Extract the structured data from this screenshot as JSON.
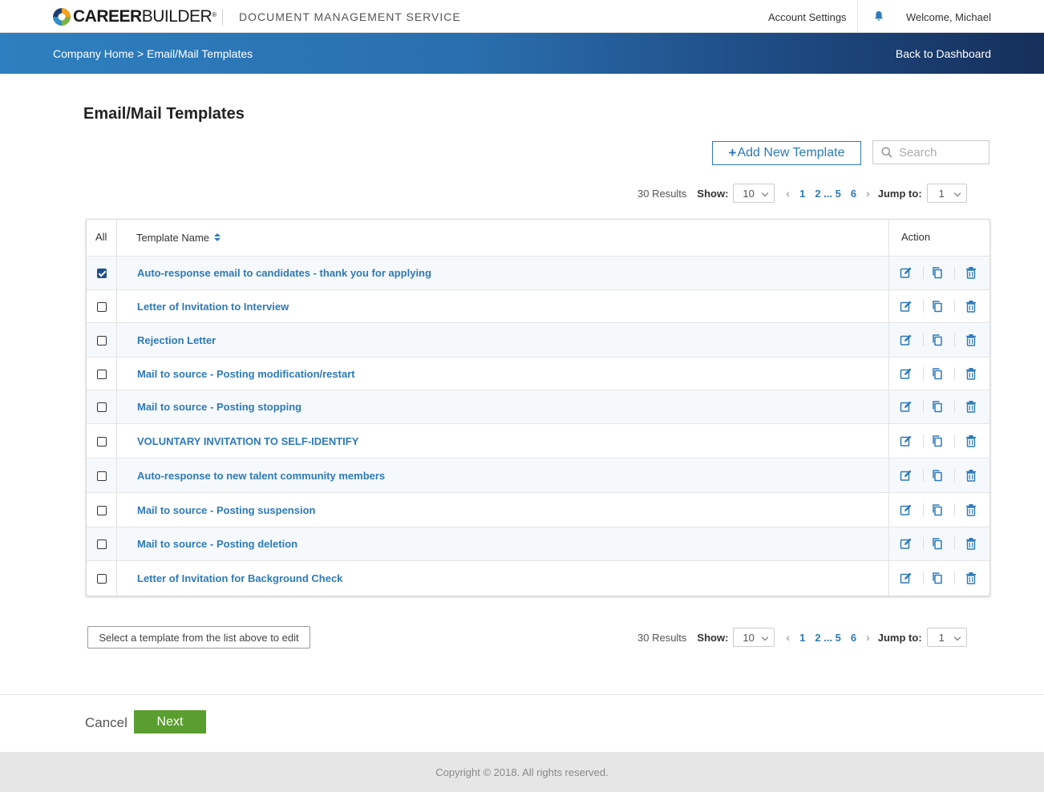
{
  "header": {
    "logo_bold": "CAREER",
    "logo_light": "BUILDER",
    "logo_reg": "®",
    "service_name": "DOCUMENT MANAGEMENT SERVICE",
    "account_settings": "Account Settings",
    "welcome": "Welcome, Michael"
  },
  "nav": {
    "breadcrumb": "Company Home > Email/Mail Templates",
    "back": "Back to Dashboard"
  },
  "page": {
    "title": "Email/Mail Templates",
    "add_button": "Add New Template",
    "add_plus": "+",
    "search_placeholder": "Search"
  },
  "pagination": {
    "results": "30 Results",
    "show_label": "Show:",
    "show_value": "10",
    "prev": "‹",
    "next": "›",
    "page_1": "1",
    "page_range": "2 ... 5",
    "page_6": "6",
    "jump_label": "Jump to:",
    "jump_value": "1"
  },
  "table": {
    "col_all": "All",
    "col_name": "Template Name",
    "col_action": "Action",
    "rows": [
      {
        "name": "Auto-response email to candidates - thank you for applying",
        "checked": true
      },
      {
        "name": "Letter of Invitation to Interview",
        "checked": false
      },
      {
        "name": "Rejection Letter",
        "checked": false
      },
      {
        "name": "Mail to source - Posting modification/restart",
        "checked": false
      },
      {
        "name": "Mail to source - Posting stopping",
        "checked": false
      },
      {
        "name": "VOLUNTARY INVITATION TO SELF-IDENTIFY",
        "checked": false
      },
      {
        "name": "Auto-response to new talent community members",
        "checked": false
      },
      {
        "name": "Mail to source - Posting suspension",
        "checked": false
      },
      {
        "name": "Mail to source - Posting deletion",
        "checked": false
      },
      {
        "name": "Letter of Invitation for Background Check",
        "checked": false
      }
    ]
  },
  "footer": {
    "select_hint": "Select a template from the list above to edit",
    "cancel": "Cancel",
    "next": "Next",
    "copyright": "Copyright © 2018. All rights reserved."
  },
  "colors": {
    "accent": "#2d7ab8",
    "next_green": "#5a9e2f",
    "check_blue": "#1f4f8a"
  },
  "icons": {
    "edit": "edit-icon",
    "copy": "copy-icon",
    "delete": "trash-icon",
    "search": "search-icon",
    "bell": "bell-icon",
    "sort": "sort-icon"
  }
}
